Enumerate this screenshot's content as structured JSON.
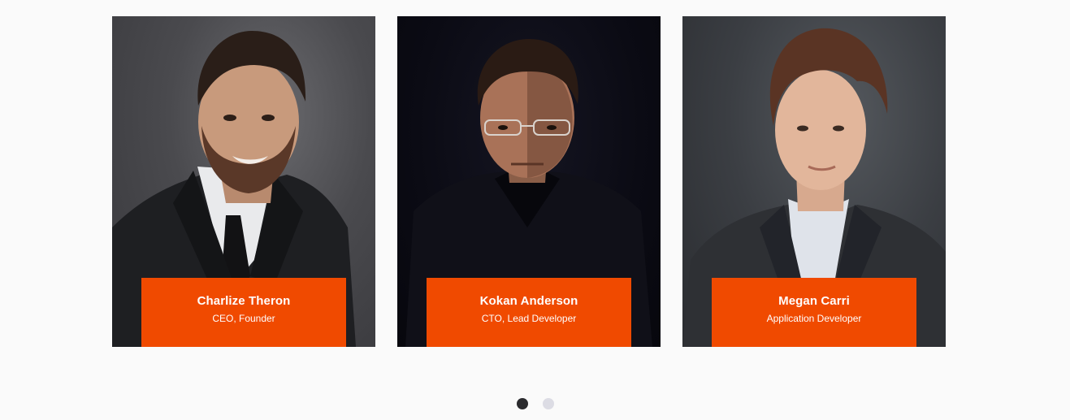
{
  "team": [
    {
      "name": "Charlize Theron",
      "role": "CEO, Founder"
    },
    {
      "name": "Kokan Anderson",
      "role": "CTO, Lead Developer"
    },
    {
      "name": "Megan Carri",
      "role": "Application Developer"
    }
  ],
  "pagination": {
    "total": 2,
    "active": 1
  },
  "colors": {
    "accent": "#f04a00",
    "background": "#fafafa",
    "dot_active": "#2b2b2e",
    "dot_inactive": "#dcdce4"
  }
}
